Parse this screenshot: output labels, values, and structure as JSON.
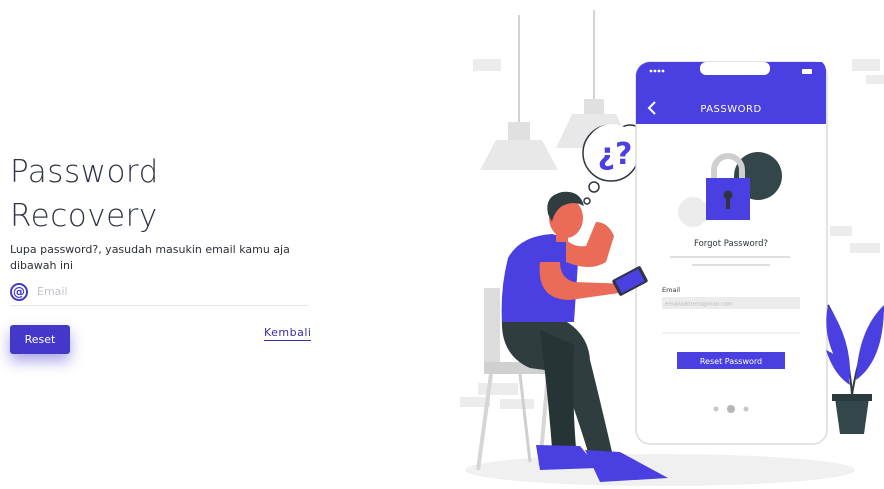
{
  "page": {
    "title": "Password Recovery",
    "subtitle": "Lupa password?, yasudah masukin email kamu aja dibawah ini"
  },
  "form": {
    "email_placeholder": "Email",
    "email_value": "",
    "reset_label": "Reset",
    "back_label": "Kembali"
  },
  "illustration": {
    "phone_header": "PASSWORD",
    "question_text": "¿?",
    "forgot_label": "Forgot Password?",
    "email_label": "Email",
    "email_placeholder": "emailaddress@mail.com",
    "button_label": "Reset Password"
  },
  "colors": {
    "accent": "#4338ca",
    "phone_accent": "#4a3fe0",
    "skin": "#ea6b57",
    "dark": "#2f3d3f"
  }
}
